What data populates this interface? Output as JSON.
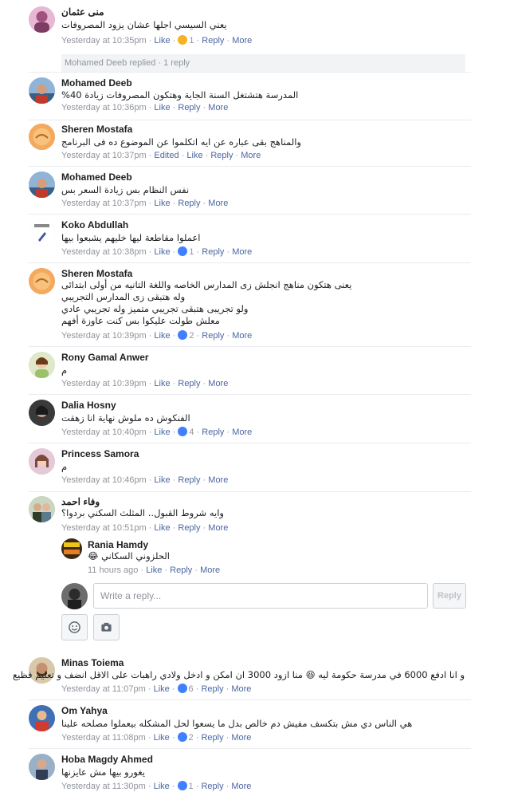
{
  "labels": {
    "like": "Like",
    "reply": "Reply",
    "more": "More",
    "edited": "Edited",
    "dot": "·"
  },
  "comments": [
    {
      "author": "منى عثمان",
      "text": [
        "يعني السيسي اجلها عشان يزود المصروفات"
      ],
      "time": "Yesterday at 10:35pm",
      "reactions": "1",
      "reaction_icon": "haha-icon",
      "replies_summary": "Mohamed Deeb replied · 1 reply"
    },
    {
      "author": "Mohamed Deeb",
      "text": [
        "المدرسة هتشتغل السنة الجاية وهتكون المصروفات زيادة 40%"
      ],
      "time": "Yesterday at 10:36pm"
    },
    {
      "author": "Sheren Mostafa",
      "text": [
        "والمناهج بقى عباره عن ايه اتكلموا عن الموضوع ده فى البرنامج"
      ],
      "time": "Yesterday at 10:37pm",
      "edited": true
    },
    {
      "author": "Mohamed Deeb",
      "text": [
        "نفس النظام بس زيادة السعر بس"
      ],
      "time": "Yesterday at 10:37pm"
    },
    {
      "author": "Koko Abdullah",
      "text": [
        "اعملوا مقاطعة ليها خليهم يشبعوا بيها"
      ],
      "time": "Yesterday at 10:38pm",
      "reactions": "1",
      "reaction_icon": "like-icon"
    },
    {
      "author": "Sheren Mostafa",
      "text": [
        "يعنى هتكون مناهج انجلش زى المدارس الخاصه واللغة التانيه من أولى ابتدائى",
        "وله هتبقى زى المدارس التجريبي",
        "ولو تجريبى هتبقى تجريبي متميز وله تجريبي عادي",
        "معلش طولت عليكوا بس كنت عاوزة أفهم"
      ],
      "time": "Yesterday at 10:39pm",
      "reactions": "2",
      "reaction_icon": "like-icon"
    },
    {
      "author": "Rony Gamal Anwer",
      "text": [
        "م"
      ],
      "time": "Yesterday at 10:39pm"
    },
    {
      "author": "Dalia Hosny",
      "text": [
        "الفنكوش ده ملوش نهاية انا زهقت"
      ],
      "time": "Yesterday at 10:40pm",
      "reactions": "4",
      "reaction_icon": "like-icon"
    },
    {
      "author": "Princess Samora",
      "text": [
        "م"
      ],
      "time": "Yesterday at 10:46pm"
    },
    {
      "author": "وفاء احمد",
      "text": [
        "وايه شروط القبول.. المثلث السكني بردوا؟"
      ],
      "time": "Yesterday at 10:51pm"
    },
    {
      "author": "Minas Toiema",
      "text": [
        "و انا ادفع 6000 في مدرسة حكومة ليه 😆 منا ازود 3000 ان امكن و ادخل ولادي راهبات على الاقل انضف و تعليم فظيع"
      ],
      "time": "Yesterday at 11:07pm",
      "reactions": "6",
      "reaction_icon": "like-icon"
    },
    {
      "author": "Om Yahya",
      "text": [
        "هي الناس دي مش بتكسف مفيش دم خالص بدل ما يسعوا لحل المشكله بيعملوا مصلحه علينا"
      ],
      "time": "Yesterday at 11:08pm",
      "reactions": "2",
      "reaction_icon": "like-icon"
    },
    {
      "author": "Hoba Magdy Ahmed",
      "text": [
        "يغورو بيها مش عايزنها"
      ],
      "time": "Yesterday at 11:30pm",
      "reactions": "1",
      "reaction_icon": "like-icon"
    }
  ],
  "nested_reply": {
    "author": "Rania Hamdy",
    "text": "الحلزوني السكاني 😂",
    "time": "11 hours ago"
  },
  "composer": {
    "placeholder": "Write a reply...",
    "reply_button": "Reply",
    "emoji_icon": "smiley-icon",
    "camera_icon": "camera-icon"
  },
  "colors": {
    "link": "#4b67a1",
    "meta": "#90949c",
    "like": "#4080ff",
    "divider": "#e9ebee"
  }
}
